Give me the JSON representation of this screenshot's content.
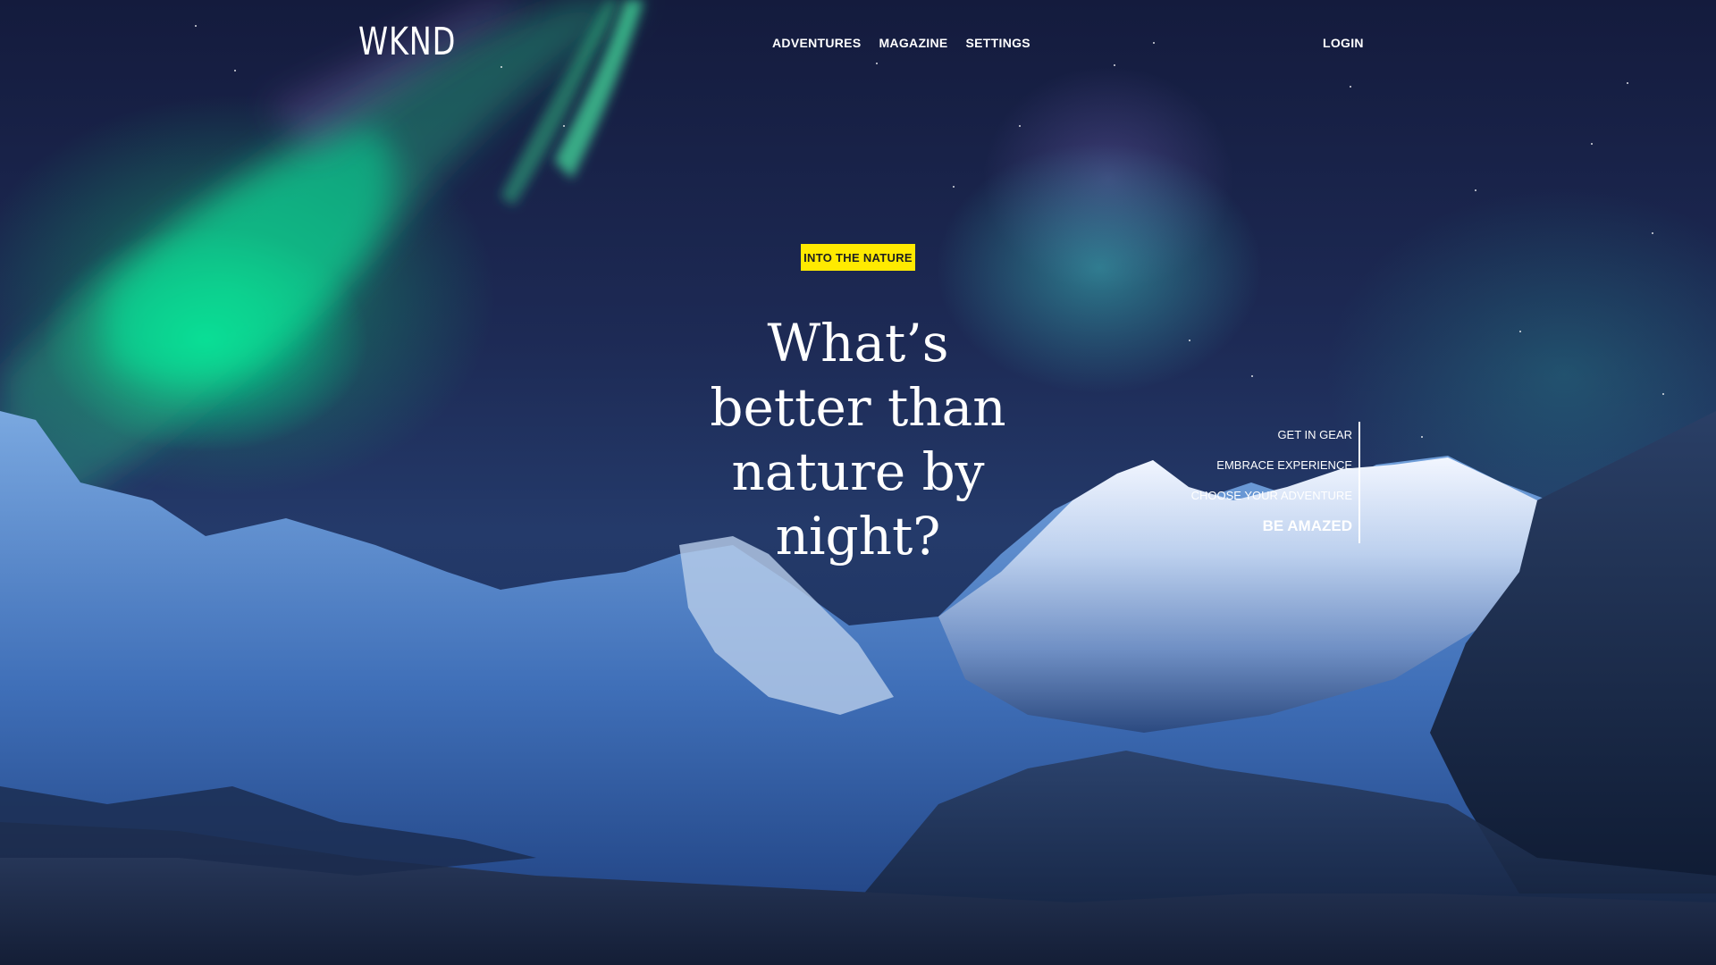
{
  "brand": {
    "logo": "WKND"
  },
  "nav": {
    "items": [
      {
        "label": "ADVENTURES"
      },
      {
        "label": "MAGAZINE"
      },
      {
        "label": "SETTINGS"
      }
    ],
    "login": "LOGIN"
  },
  "hero": {
    "tag": "INTO THE NATURE",
    "headline": "What’s better than nature by night?",
    "image": "aurora-mountains-night"
  },
  "carousel": {
    "items": [
      {
        "label": "GET IN GEAR",
        "active": false
      },
      {
        "label": "EMBRACE EXPERIENCE",
        "active": false
      },
      {
        "label": "CHOOSE YOUR ADVENTURE",
        "active": false
      },
      {
        "label": "BE AMAZED",
        "active": true
      }
    ]
  },
  "colors": {
    "accent": "#ffea00",
    "text": "#ffffff",
    "sky": "#1d2a55"
  }
}
